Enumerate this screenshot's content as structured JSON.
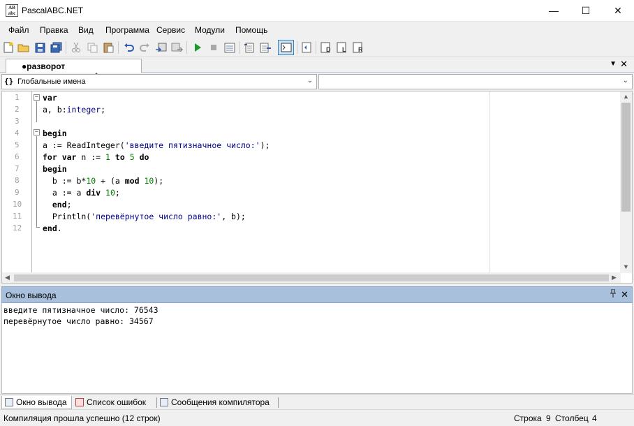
{
  "window": {
    "title": "PascalABC.NET",
    "app_icon_text": "AB\nabc",
    "minimize_glyph": "—",
    "maximize_glyph": "☐",
    "close_glyph": "✕"
  },
  "menu": [
    "Файл",
    "Правка",
    "Вид",
    "Программа",
    "Сервис",
    "Модули",
    "Помощь"
  ],
  "toolbar": {
    "icons": [
      "new-file-icon",
      "open-folder-icon",
      "save-icon",
      "save-all-icon",
      "cut-icon",
      "copy-icon",
      "paste-icon",
      "undo-icon",
      "redo-icon",
      "compile-icon",
      "build-icon",
      "run-icon",
      "stop-icon",
      "debug-icon",
      "step-over-icon",
      "step-into-icon",
      "console-icon",
      "format-icon",
      "form-icon",
      "lib-icon",
      "ref-icon"
    ]
  },
  "tab": {
    "label": "●разворот пятизначного.pas*",
    "dropdown_glyph": "▼",
    "close_glyph": "✕"
  },
  "combo": {
    "left_icon": "{}",
    "left_text": "Глобальные имена",
    "right_text": "",
    "arrow_glyph": "⌄"
  },
  "editor": {
    "line_numbers": [
      "1",
      "2",
      "3",
      "4",
      "5",
      "6",
      "7",
      "8",
      "9",
      "10",
      "11",
      "12"
    ],
    "lines": [
      [
        {
          "t": "var",
          "c": "kw"
        }
      ],
      [
        {
          "t": "a, b:",
          "c": ""
        },
        {
          "t": "integer",
          "c": "str"
        },
        {
          "t": ";",
          "c": ""
        }
      ],
      [],
      [
        {
          "t": "begin",
          "c": "kw"
        }
      ],
      [
        {
          "t": "a := ReadInteger(",
          "c": ""
        },
        {
          "t": "'введите пятизначное число:'",
          "c": "str"
        },
        {
          "t": ");",
          "c": ""
        }
      ],
      [
        {
          "t": "for var",
          "c": "kw"
        },
        {
          "t": " n := ",
          "c": ""
        },
        {
          "t": "1",
          "c": "num"
        },
        {
          "t": " ",
          "c": ""
        },
        {
          "t": "to",
          "c": "kw"
        },
        {
          "t": " ",
          "c": ""
        },
        {
          "t": "5",
          "c": "num"
        },
        {
          "t": " ",
          "c": ""
        },
        {
          "t": "do",
          "c": "kw"
        }
      ],
      [
        {
          "t": "begin",
          "c": "kw"
        }
      ],
      [
        {
          "t": "  b := b*",
          "c": ""
        },
        {
          "t": "10",
          "c": "num"
        },
        {
          "t": " + (a ",
          "c": ""
        },
        {
          "t": "mod",
          "c": "kw"
        },
        {
          "t": " ",
          "c": ""
        },
        {
          "t": "10",
          "c": "num"
        },
        {
          "t": ");",
          "c": ""
        }
      ],
      [
        {
          "t": "  a := a ",
          "c": ""
        },
        {
          "t": "div",
          "c": "kw"
        },
        {
          "t": " ",
          "c": ""
        },
        {
          "t": "10",
          "c": "num"
        },
        {
          "t": ";",
          "c": ""
        }
      ],
      [
        {
          "t": "  end",
          "c": "kw"
        },
        {
          "t": ";",
          "c": ""
        }
      ],
      [
        {
          "t": "  Println(",
          "c": ""
        },
        {
          "t": "'перевёрнутое число равно:'",
          "c": "str"
        },
        {
          "t": ", b);",
          "c": ""
        }
      ],
      [
        {
          "t": "end",
          "c": "kw"
        },
        {
          "t": ".",
          "c": ""
        }
      ]
    ]
  },
  "output": {
    "title": "Окно вывода",
    "pin_glyph": "📌",
    "close_glyph": "✕",
    "lines": [
      "введите пятизначное число: 76543",
      "перевёрнутое число равно: 34567"
    ]
  },
  "bottom_tabs": [
    "Окно вывода",
    "Список ошибок",
    "Сообщения компилятора"
  ],
  "status": {
    "message": "Компиляция прошла успешно (12 строк)",
    "line_label": "Строка",
    "line_value": "9",
    "col_label": "Столбец",
    "col_value": "4"
  }
}
